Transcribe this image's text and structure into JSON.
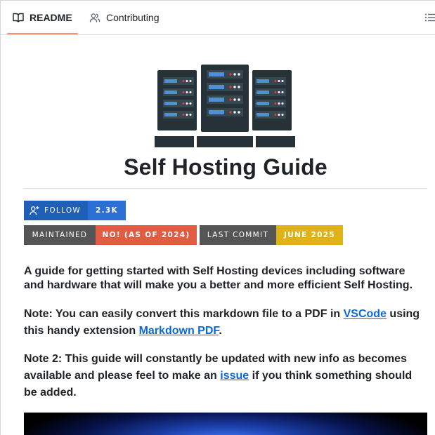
{
  "tabs": {
    "readme_label": "README",
    "contributing_label": "Contributing"
  },
  "title": "Self Hosting Guide",
  "badges": {
    "follow_label": "FOLLOW",
    "follow_count": "2.3K",
    "maintained_label": "MAINTAINED",
    "maintained_value": "NO! (AS OF 2024)",
    "last_commit_label": "LAST COMMIT",
    "last_commit_value": "JUNE 2025"
  },
  "paragraphs": {
    "intro": "A guide for getting started with Self Hosting devices including software and hardware that will make you a better and more efficient Self Hosting.",
    "note1_before": "Note: You can easily convert this markdown file to a PDF in ",
    "note1_link1": "VSCode",
    "note1_middle": " using this handy extension ",
    "note1_link2": "Markdown PDF",
    "note1_after": ".",
    "note2_before": "Note 2: This guide will constantly be updated with new info as becomes available and please feel to make an ",
    "note2_link": "issue",
    "note2_after": " if you think something should be added."
  },
  "colors": {
    "tab_underline": "#fd8c73",
    "link": "#0969da",
    "follow_left": "#1f5fb5",
    "follow_right": "#2c6fd4",
    "badge_gray": "#555555",
    "maintained_red": "#e05d44",
    "commit_yellow": "#dfb317"
  },
  "icons": {
    "readme_tab": "book-icon",
    "contributing_tab": "people-icon",
    "outline": "list-unordered-icon",
    "follow": "person-add-icon"
  }
}
